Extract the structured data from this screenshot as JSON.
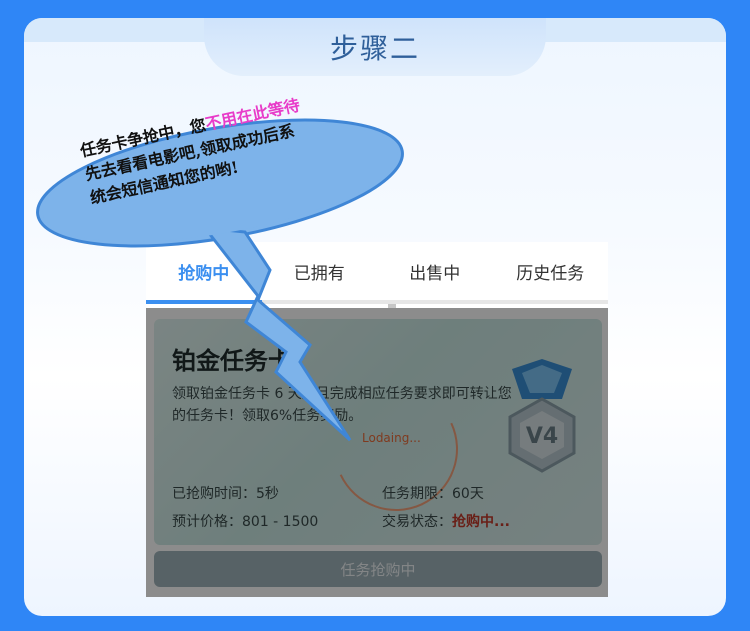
{
  "step_title": "步骤二",
  "bubble": {
    "line1_prefix": "任务卡争抢中，您",
    "line1_highlight": "不用在此等待",
    "line2": "先去看看电影吧,领取成功后系",
    "line3": "统会短信通知您的哟!"
  },
  "tabs": [
    {
      "label": "抢购中",
      "active": true
    },
    {
      "label": "已拥有",
      "active": false
    },
    {
      "label": "出售中",
      "active": false
    },
    {
      "label": "历史任务",
      "active": false
    }
  ],
  "card": {
    "title": "铂金任务卡",
    "description": "领取铂金任务卡 6 天后且完成相应任务要求即可转让您的任务卡！领取6%任务奖励。",
    "badge_text": "V4",
    "loading_text": "Lodaing...",
    "info": {
      "grab_time_label": "已抢购时间：",
      "grab_time_value": "5秒",
      "period_label": "任务期限：",
      "period_value": "60天",
      "price_label": "预计价格：",
      "price_value": "801 - 1500",
      "status_label": "交易状态：",
      "status_value": "抢购中..."
    },
    "button_label": "任务抢购中"
  },
  "colors": {
    "background": "#2f86f6",
    "accent_blue": "#3b8ff0",
    "bubble_fill": "#7db3ea",
    "highlight_pink": "#e83cc9",
    "status_red": "#c0392b"
  }
}
